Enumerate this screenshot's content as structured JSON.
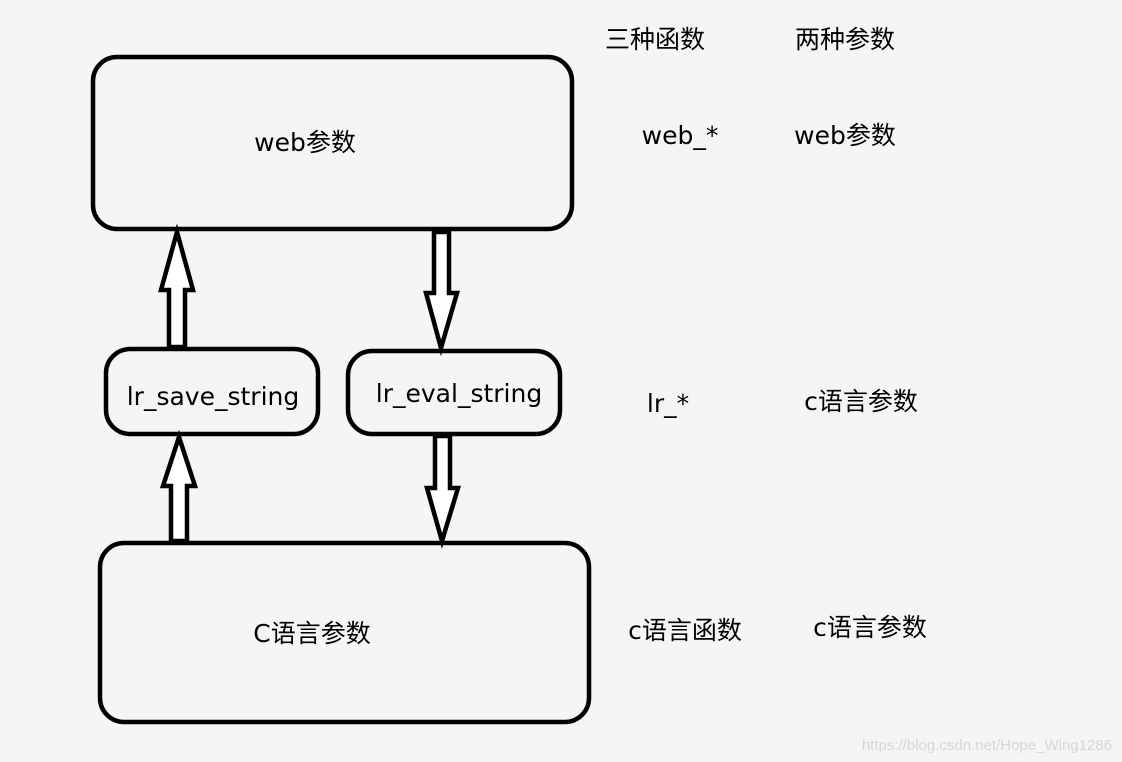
{
  "boxes": {
    "web_params": "web参数",
    "lr_save_string": "lr_save_string",
    "lr_eval_string": "lr_eval_string",
    "c_params": "C语言参数"
  },
  "table": {
    "headers": [
      "三种函数",
      "两种参数"
    ],
    "rows": [
      [
        "web_*",
        "web参数"
      ],
      [
        "lr_*",
        "c语言参数"
      ],
      [
        "c语言函数",
        "c语言参数"
      ]
    ]
  },
  "arrows": [
    {
      "from": "lr_save_string",
      "to": "web参数"
    },
    {
      "from": "web参数",
      "to": "lr_eval_string"
    },
    {
      "from": "C语言参数",
      "to": "lr_save_string"
    },
    {
      "from": "lr_eval_string",
      "to": "C语言参数"
    }
  ],
  "watermark": "https://blog.csdn.net/Hope_Wing1286"
}
